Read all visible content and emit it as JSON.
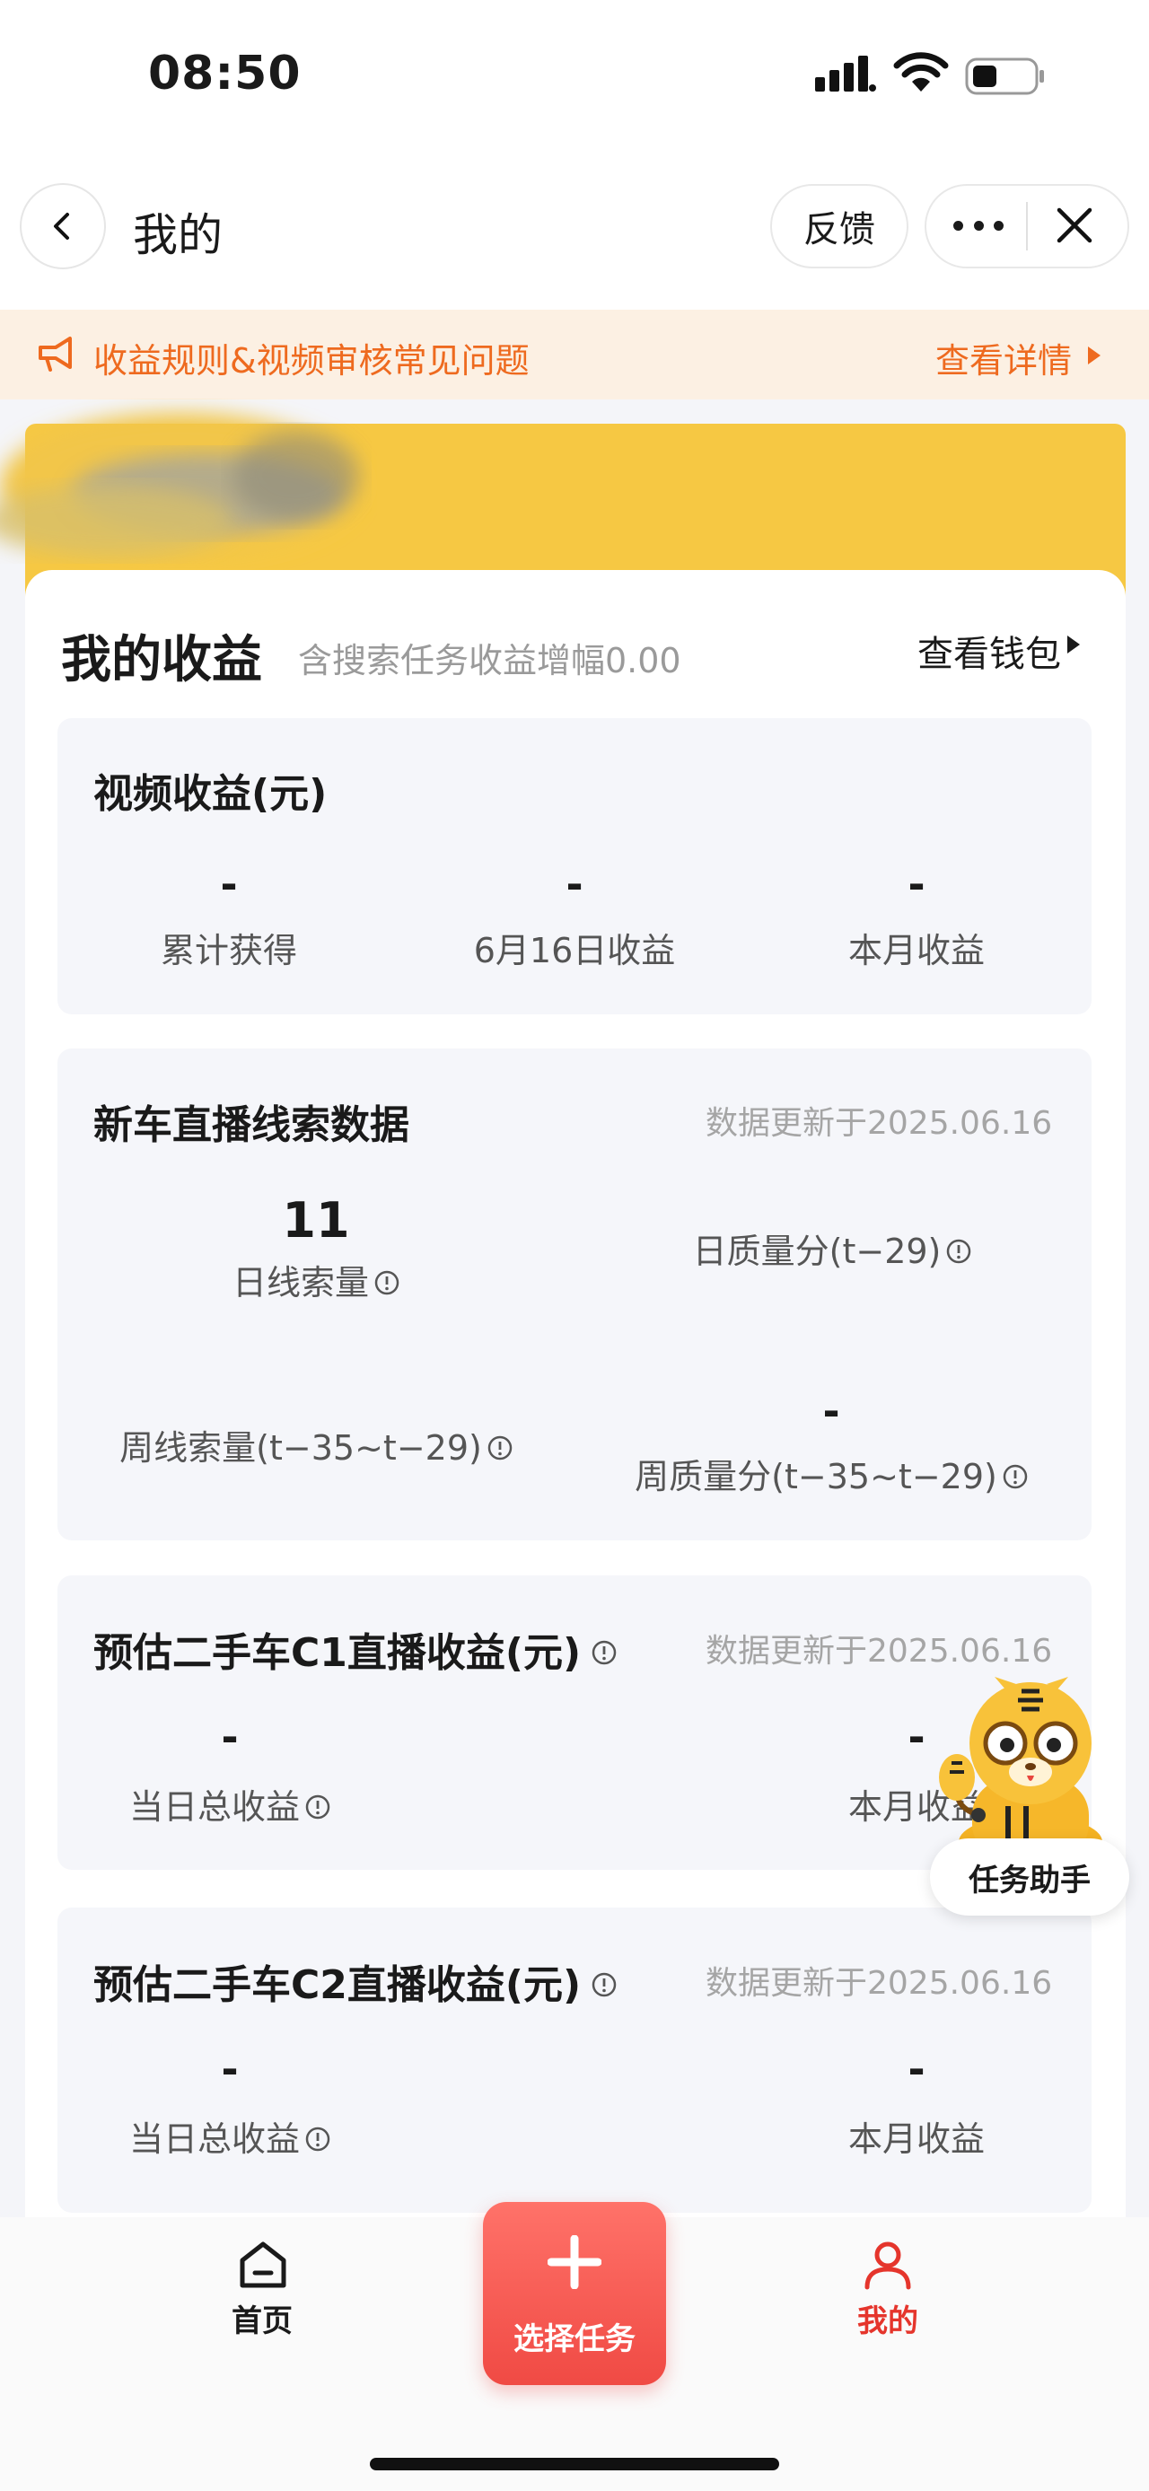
{
  "status_bar": {
    "time": "08:50"
  },
  "nav": {
    "title": "我的",
    "feedback": "反馈"
  },
  "notice": {
    "text": "收益规则&视频审核常见问题",
    "link": "查看详情"
  },
  "earnings": {
    "title": "我的收益",
    "subtitle": "含搜索任务收益增幅0.00",
    "wallet": "查看钱包",
    "video": {
      "title": "视频收益(元)",
      "items": [
        {
          "value": "-",
          "label": "累计获得"
        },
        {
          "value": "-",
          "label": "6月16日收益"
        },
        {
          "value": "-",
          "label": "本月收益"
        }
      ]
    },
    "new_car": {
      "title": "新车直播线索数据",
      "updated": "数据更新于2025.06.16",
      "daily_leads": {
        "value": "11",
        "label": "日线索量"
      },
      "daily_quality": {
        "value": "",
        "label": "日质量分(t−29)"
      },
      "weekly_leads": {
        "value": "",
        "label": "周线索量(t−35~t−29)"
      },
      "weekly_quality": {
        "value": "-",
        "label": "周质量分(t−35~t−29)"
      }
    },
    "c1": {
      "title": "预估二手车C1直播收益(元)",
      "updated": "数据更新于2025.06.16",
      "day": {
        "value": "-",
        "label": "当日总收益"
      },
      "month": {
        "value": "-",
        "label": "本月收益"
      }
    },
    "c2": {
      "title": "预估二手车C2直播收益(元)",
      "updated": "数据更新于2025.06.16",
      "day": {
        "value": "-",
        "label": "当日总收益"
      },
      "month": {
        "value": "-",
        "label": "本月收益"
      }
    }
  },
  "assistant": {
    "label": "任务助手"
  },
  "tabbar": {
    "home": "首页",
    "select": "选择任务",
    "mine": "我的"
  },
  "colors": {
    "accent": "#e5352c",
    "notice": "#ee6a1f",
    "banner": "#f6c843"
  }
}
